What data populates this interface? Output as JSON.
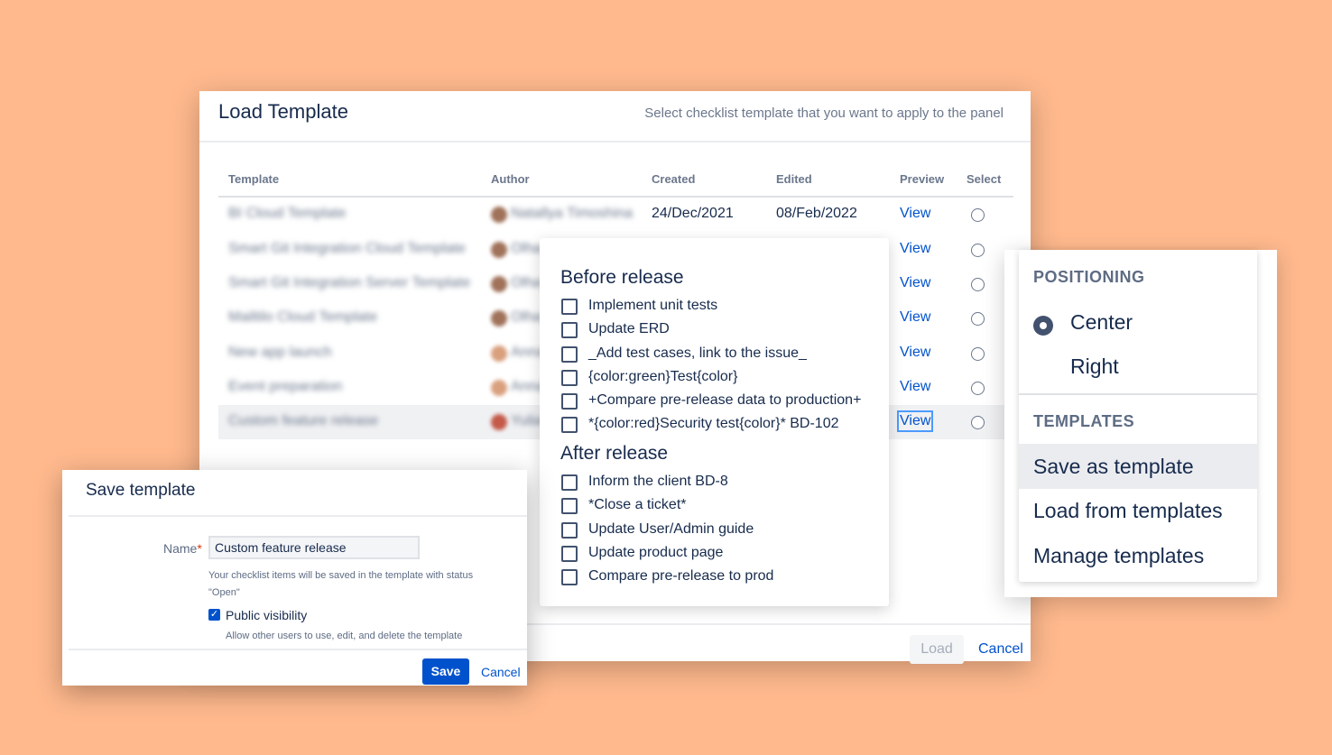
{
  "load_dialog": {
    "title": "Load Template",
    "subtitle": "Select checklist template that you want to apply to the panel",
    "columns": [
      "Template",
      "Author",
      "Created",
      "Edited",
      "Preview",
      "Select"
    ],
    "rows": [
      {
        "template": "BI Cloud Template",
        "author": "Natallya Timoshina",
        "created": "24/Dec/2021",
        "edited": "08/Feb/2022",
        "preview": "View"
      },
      {
        "template": "Smart Git Integration Cloud Template",
        "author": "Olha",
        "created": "",
        "edited": "",
        "preview": "View"
      },
      {
        "template": "Smart Git Integration Server Template",
        "author": "Olha",
        "created": "",
        "edited": "",
        "preview": "View"
      },
      {
        "template": "Mailtilo Cloud Template",
        "author": "Olha",
        "created": "",
        "edited": "",
        "preview": "View"
      },
      {
        "template": "New app launch",
        "author": "Anna",
        "created": "",
        "edited": "",
        "preview": "View"
      },
      {
        "template": "Event preparation",
        "author": "Anna",
        "created": "",
        "edited": "",
        "preview": "View"
      },
      {
        "template": "Custom feature release",
        "author": "Yulia",
        "created": "",
        "edited": "",
        "preview": "View"
      }
    ],
    "load_label": "Load",
    "cancel_label": "Cancel"
  },
  "preview": {
    "sections": [
      {
        "title": "Before release",
        "items": [
          "Implement unit tests",
          "Update ERD",
          "_Add test cases, link to the issue_",
          "{color:green}Test{color}",
          "+Compare pre-release data to production+",
          "*{color:red}Security test{color}* BD-102"
        ]
      },
      {
        "title": "After release",
        "items": [
          "Inform the client BD-8",
          "*Close a ticket*",
          "Update User/Admin guide",
          "Update product page",
          "Compare pre-release to prod"
        ]
      }
    ]
  },
  "menu": {
    "positioning_title": "POSITIONING",
    "center_label": "Center",
    "right_label": "Right",
    "templates_title": "TEMPLATES",
    "save_as_label": "Save as template",
    "load_from_label": "Load from templates",
    "manage_label": "Manage templates"
  },
  "save_dialog": {
    "title": "Save template",
    "name_label": "Name",
    "required_mark": "*",
    "name_value": "Custom feature release",
    "help_status": "Your checklist items will be saved in the template with status \"Open\"",
    "public_label": "Public visibility",
    "public_help": "Allow other users to use, edit, and delete the template",
    "save_label": "Save",
    "cancel_label": "Cancel"
  }
}
